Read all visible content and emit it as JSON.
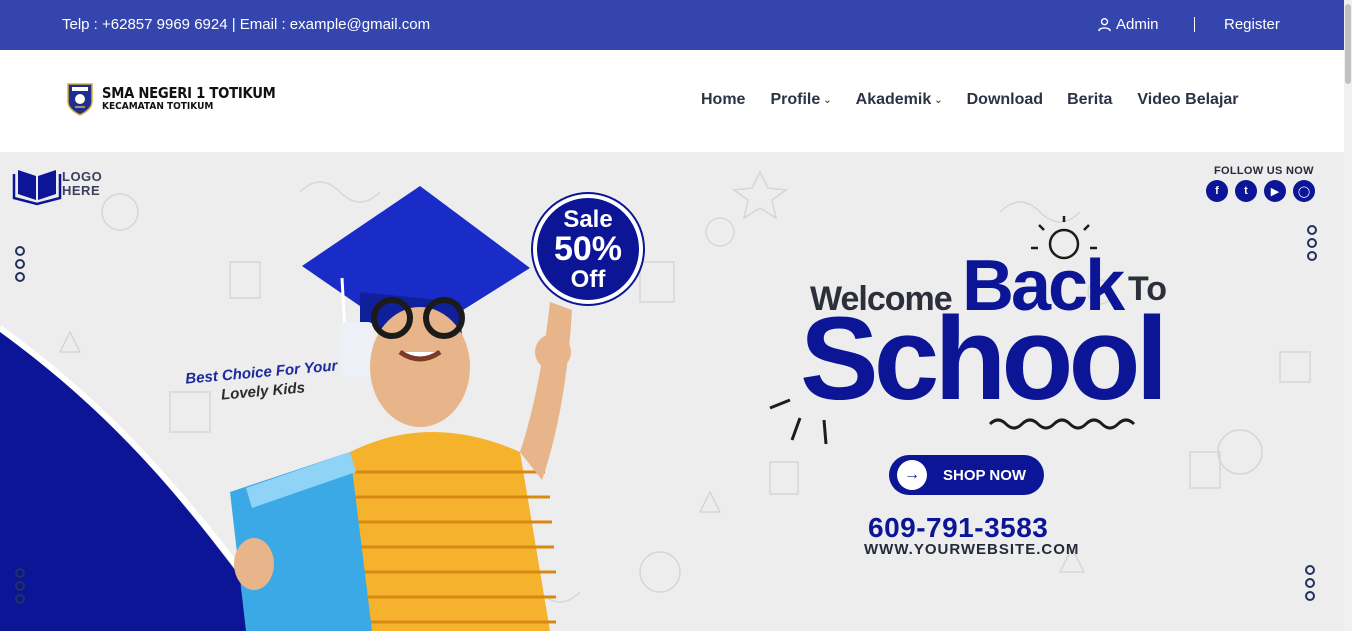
{
  "topbar": {
    "contact": "Telp : +62857 9969 6924 | Email : example@gmail.com",
    "admin_label": "Admin",
    "register_label": "Register",
    "admin_icon": "user-icon"
  },
  "brand": {
    "name": "SMA NEGERI 1 TOTIKUM",
    "subtitle": "KECAMATAN TOTIKUM",
    "emblem_icon": "school-emblem-icon"
  },
  "menu": [
    {
      "label": "Home",
      "has_dropdown": false
    },
    {
      "label": "Profile",
      "has_dropdown": true
    },
    {
      "label": "Akademik",
      "has_dropdown": true
    },
    {
      "label": "Download",
      "has_dropdown": false
    },
    {
      "label": "Berita",
      "has_dropdown": false
    },
    {
      "label": "Video Belajar",
      "has_dropdown": false
    }
  ],
  "banner": {
    "logo_line1": "LOGO",
    "logo_line2": "HERE",
    "follow_label": "FOLLOW US NOW",
    "socials": [
      "facebook-icon",
      "twitter-icon",
      "youtube-icon",
      "instagram-icon"
    ],
    "sale_line1": "Sale",
    "sale_line2": "50%",
    "sale_line3": "Off",
    "best_line1": "Best Choice For Your",
    "best_line2": "Lovely Kids",
    "welcome": "Welcome",
    "back": "Back",
    "to": "To",
    "school": "School",
    "shop_label": "SHOP NOW",
    "phone": "609-791-3583",
    "website": "WWW.YOURWEBSITE.COM"
  },
  "colors": {
    "topbar": "#3446ad",
    "accent": "#0b1596",
    "banner_bg": "#ededed",
    "nav_text": "#2b3445"
  }
}
